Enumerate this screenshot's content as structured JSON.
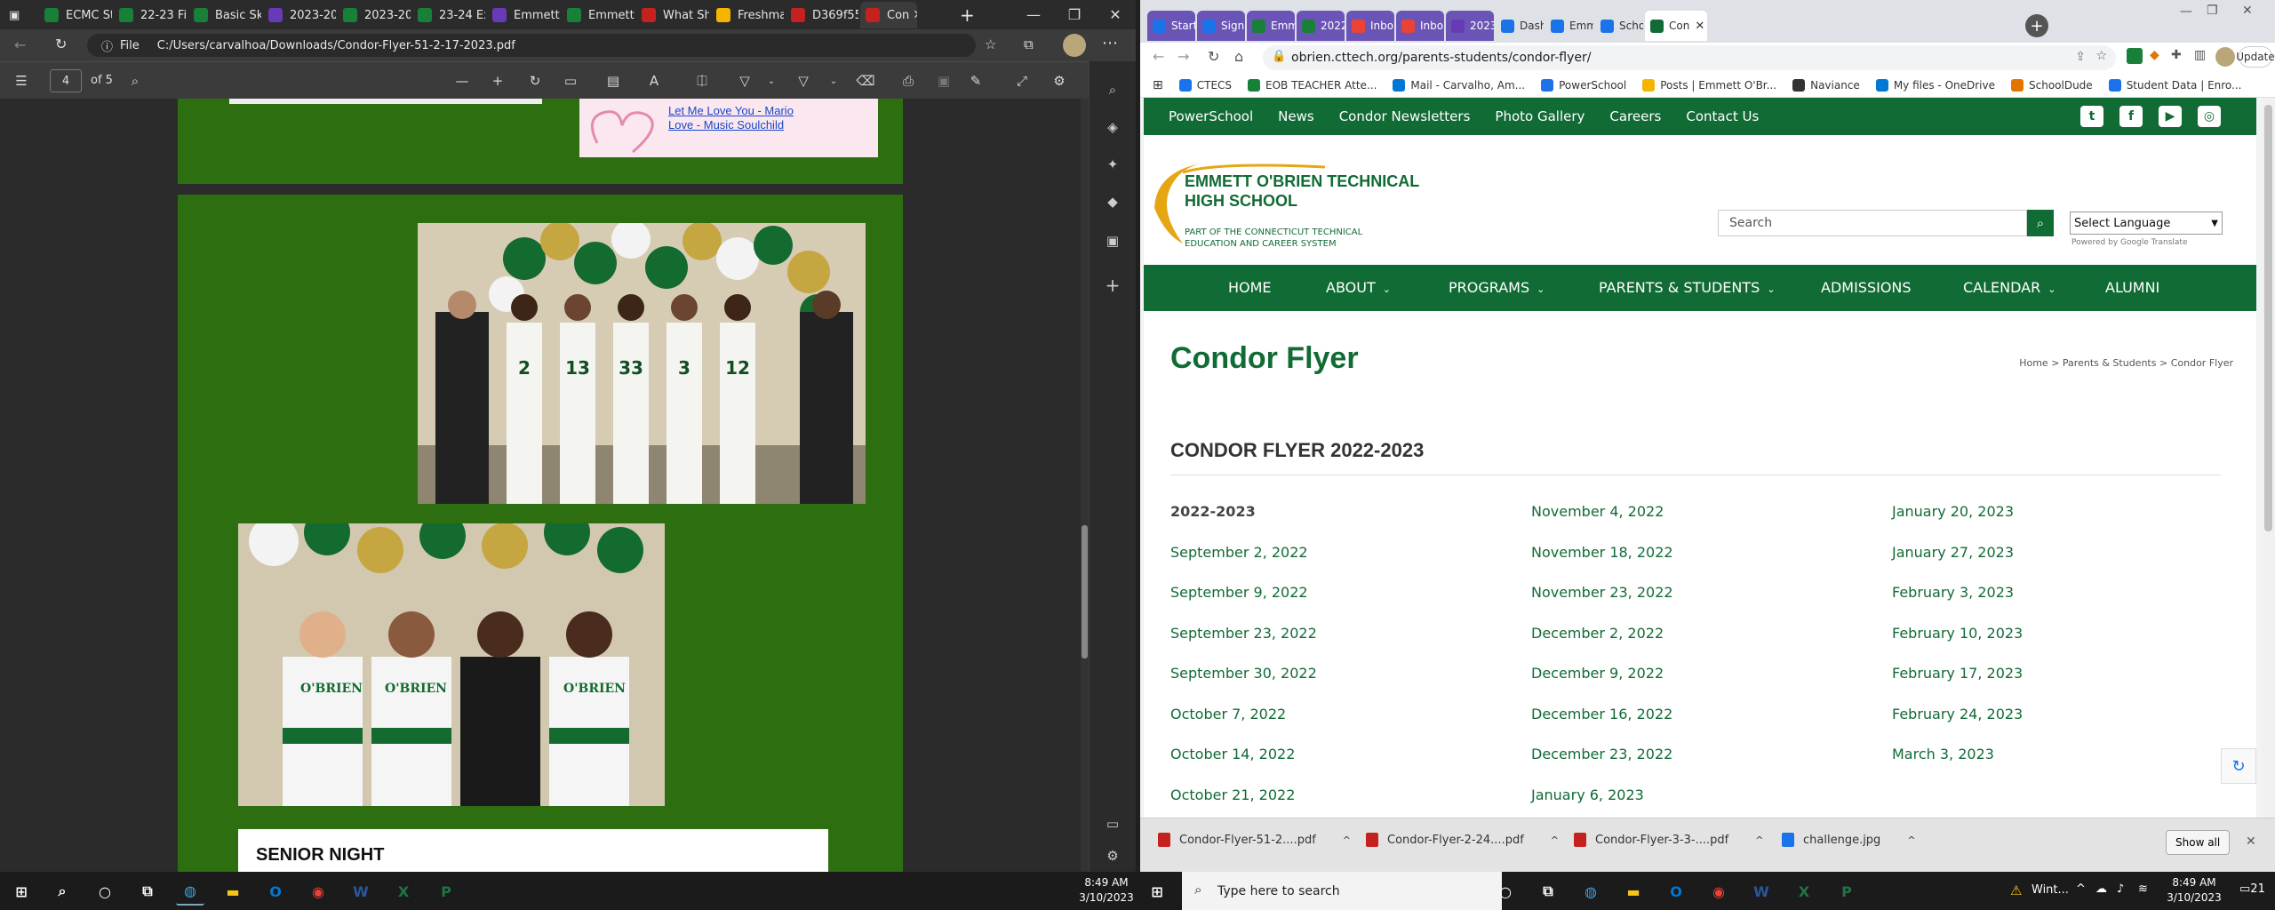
{
  "left_window": {
    "tabs": [
      {
        "label": "ECMC St",
        "icon": "sheets-icon",
        "color": "#188038"
      },
      {
        "label": "22-23 Fi",
        "icon": "sheets-icon",
        "color": "#188038"
      },
      {
        "label": "Basic Ski",
        "icon": "sheets-icon",
        "color": "#188038"
      },
      {
        "label": "2023-20",
        "icon": "forms-icon",
        "color": "#673ab7"
      },
      {
        "label": "2023-20",
        "icon": "sheets-icon",
        "color": "#188038"
      },
      {
        "label": "23-24 Ex",
        "icon": "sheets-icon",
        "color": "#188038"
      },
      {
        "label": "Emmett",
        "icon": "forms-icon",
        "color": "#673ab7"
      },
      {
        "label": "Emmett",
        "icon": "sheets-icon",
        "color": "#188038"
      },
      {
        "label": "What Sh",
        "icon": "pdf-icon",
        "color": "#c5221f"
      },
      {
        "label": "Freshma",
        "icon": "slides-icon",
        "color": "#f4b400"
      },
      {
        "label": "D369f55",
        "icon": "pdf-icon",
        "color": "#c5221f"
      },
      {
        "label": "Con",
        "icon": "pdf-icon",
        "color": "#c5221f"
      }
    ],
    "address_prefix": "File",
    "address": "C:/Users/carvalhoa/Downloads/Condor-Flyer-51-2-17-2023.pdf",
    "page_number": "4",
    "page_total": "of 5",
    "pdf_link_text": "Let Me Love You - Mario\nLove - Music Soulchild",
    "pdf_heading": "SENIOR NIGHT",
    "team_jerseys": [
      "2",
      "13",
      "33",
      "3",
      "12"
    ],
    "jersey_text": "O'BRIEN"
  },
  "right_window": {
    "tabs": [
      {
        "label": "Start",
        "icon": "sis-icon",
        "color": "#1a73e8",
        "style": "purple"
      },
      {
        "label": "Sign",
        "icon": "env-icon",
        "color": "#1a73e8",
        "style": "purple"
      },
      {
        "label": "Emm",
        "icon": "sheets-icon",
        "color": "#188038",
        "style": "purple"
      },
      {
        "label": "2022",
        "icon": "sheets-icon",
        "color": "#188038",
        "style": "purple"
      },
      {
        "label": "Inbo",
        "icon": "gmail-icon",
        "color": "#ea4335",
        "style": "purple"
      },
      {
        "label": "Inbo",
        "icon": "gmail-icon",
        "color": "#ea4335",
        "style": "purple"
      },
      {
        "label": "2023",
        "icon": "forms-icon",
        "color": "#673ab7",
        "style": "purple"
      },
      {
        "label": "Dash",
        "icon": "globe-icon",
        "color": "#1a73e8",
        "style": "plain"
      },
      {
        "label": "Emm",
        "icon": "globe-icon",
        "color": "#1a73e8",
        "style": "plain"
      },
      {
        "label": "Scho",
        "icon": "globe-icon",
        "color": "#1a73e8",
        "style": "plain"
      },
      {
        "label": "Con",
        "icon": "globe-icon",
        "color": "#116b35",
        "style": "active"
      }
    ],
    "url": "obrien.cttech.org/parents-students/condor-flyer/",
    "update_label": "Update",
    "bookmarks": [
      {
        "label": "CTECS",
        "color": "#1a73e8"
      },
      {
        "label": "EOB TEACHER Atte...",
        "color": "#188038"
      },
      {
        "label": "Mail - Carvalho, Am...",
        "color": "#0078d4"
      },
      {
        "label": "PowerSchool",
        "color": "#1a73e8"
      },
      {
        "label": "Posts | Emmett O'Br...",
        "color": "#f4b400"
      },
      {
        "label": "Naviance",
        "color": "#333333"
      },
      {
        "label": "My files - OneDrive",
        "color": "#0078d4"
      },
      {
        "label": "SchoolDude",
        "color": "#e37400"
      },
      {
        "label": "Student Data | Enro...",
        "color": "#1a73e8"
      }
    ],
    "site": {
      "top_links": [
        "PowerSchool",
        "News",
        "Condor Newsletters",
        "Photo Gallery",
        "Careers",
        "Contact Us"
      ],
      "social": [
        "twitter-icon",
        "facebook-icon",
        "youtube-icon",
        "instagram-icon"
      ],
      "logo_line1": "EMMETT O'BRIEN TECHNICAL",
      "logo_line2": "HIGH SCHOOL",
      "logo_sub1": "PART OF THE CONNECTICUT TECHNICAL",
      "logo_sub2": "EDUCATION AND CAREER SYSTEM",
      "search_placeholder": "Search",
      "language_label": "Select Language",
      "powered_by": "Powered by Google Translate",
      "main_nav": [
        "HOME",
        "ABOUT",
        "PROGRAMS",
        "PARENTS & STUDENTS",
        "ADMISSIONS",
        "CALENDAR",
        "ALUMNI"
      ],
      "page_title": "Condor Flyer",
      "breadcrumb": [
        "Home",
        "Parents & Students",
        "Condor Flyer"
      ],
      "section_heading": "CONDOR FLYER 2022-2023",
      "columns": [
        [
          "2022-2023",
          "September 2, 2022",
          "September 9, 2022",
          "September 23, 2022",
          "September 30, 2022",
          "October 7, 2022",
          "October 14, 2022",
          "October 21, 2022"
        ],
        [
          "November 4, 2022",
          "November 18, 2022",
          "November 23, 2022",
          "December 2, 2022",
          "December 9, 2022",
          "December 16, 2022",
          "December 23, 2022",
          "January 6, 2023"
        ],
        [
          "January 20, 2023",
          "January 27, 2023",
          "February 3, 2023",
          "February 10, 2023",
          "February 17, 2023",
          "February 24, 2023",
          "March 3, 2023"
        ]
      ]
    },
    "downloads": [
      "Condor-Flyer-51-2....pdf",
      "Condor-Flyer-2-24....pdf",
      "Condor-Flyer-3-3-....pdf",
      "challenge.jpg"
    ],
    "show_all": "Show all"
  },
  "taskbar": {
    "search_placeholder": "Type here to search",
    "time": "8:49 AM",
    "date": "3/10/2023",
    "weather": "Wint...",
    "notifications": "21"
  }
}
